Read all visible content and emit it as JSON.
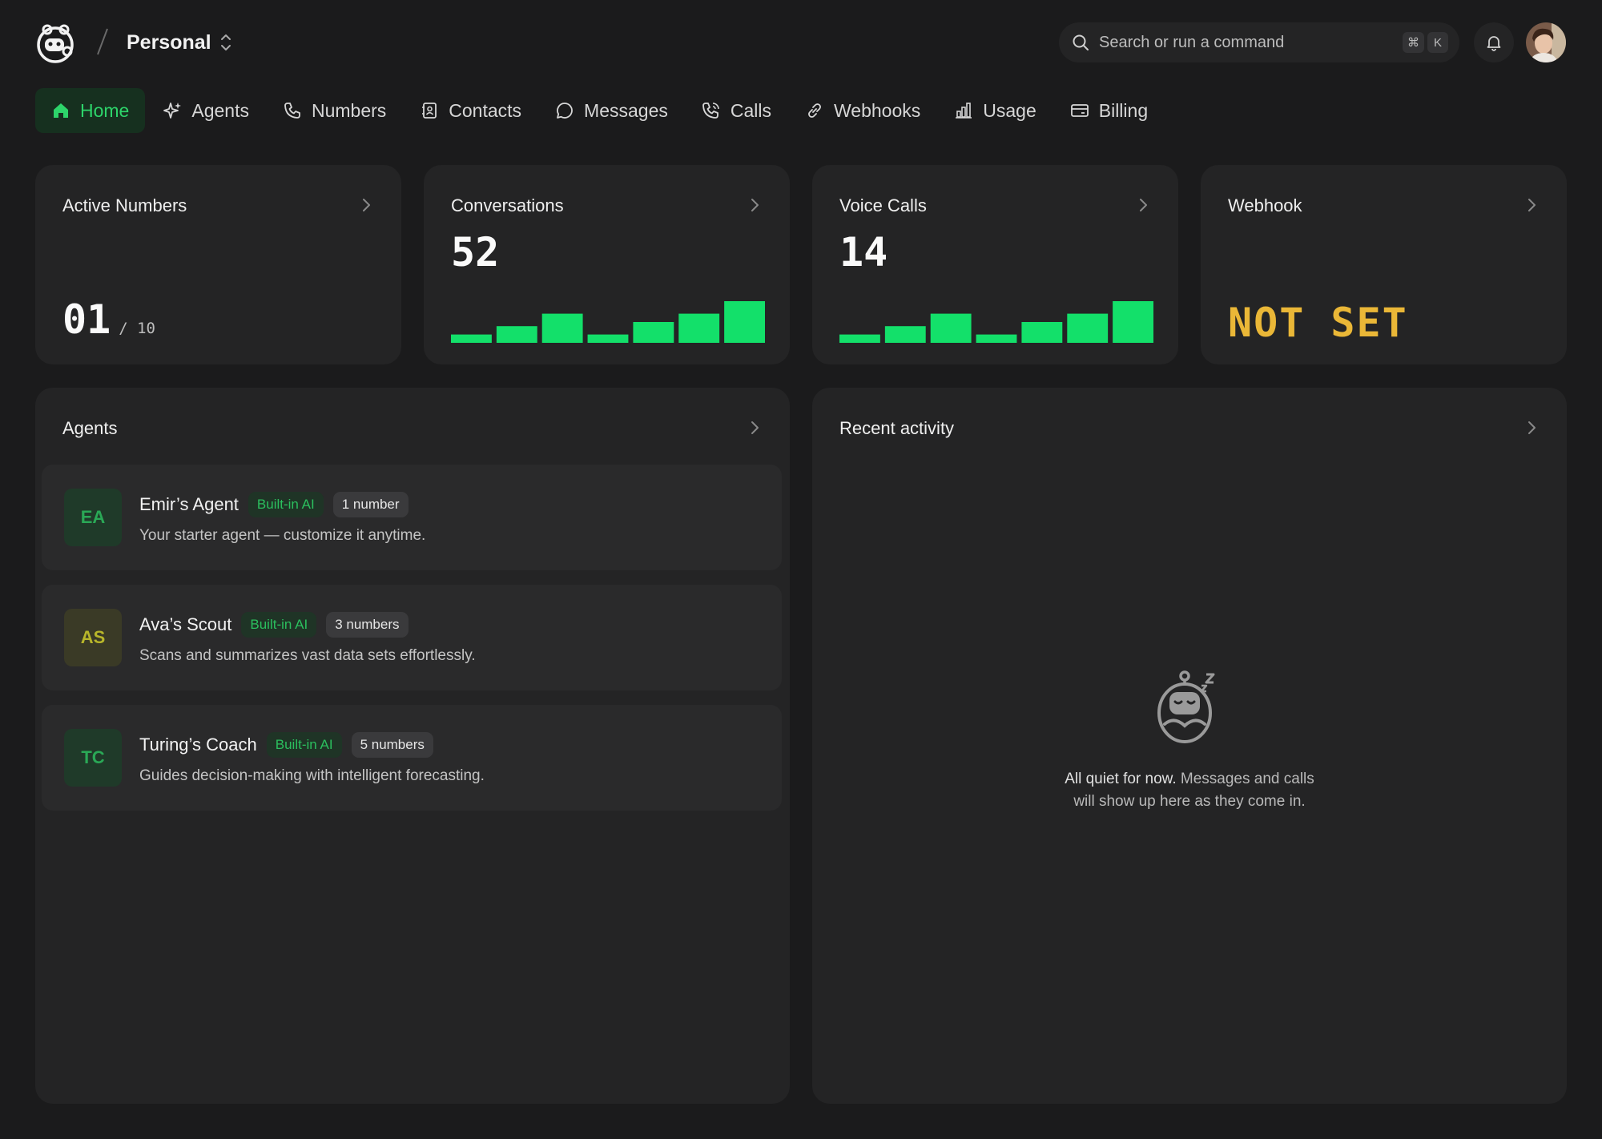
{
  "header": {
    "workspace": "Personal",
    "search_placeholder": "Search or run a command",
    "shortcut_mod": "⌘",
    "shortcut_key": "K"
  },
  "nav": {
    "tabs": [
      {
        "label": "Home",
        "icon": "home-icon",
        "active": true
      },
      {
        "label": "Agents",
        "icon": "sparkle-icon"
      },
      {
        "label": "Numbers",
        "icon": "phone-icon"
      },
      {
        "label": "Contacts",
        "icon": "contact-book-icon"
      },
      {
        "label": "Messages",
        "icon": "chat-bubble-icon"
      },
      {
        "label": "Calls",
        "icon": "phone-call-icon"
      },
      {
        "label": "Webhooks",
        "icon": "link-icon"
      },
      {
        "label": "Usage",
        "icon": "bar-chart-icon"
      },
      {
        "label": "Billing",
        "icon": "credit-card-icon"
      }
    ]
  },
  "stats": {
    "active_numbers": {
      "title": "Active Numbers",
      "value": "01",
      "total": "/ 10"
    },
    "conversations": {
      "title": "Conversations",
      "value": "52",
      "spark": [
        2,
        4,
        7,
        2,
        5,
        7,
        10
      ]
    },
    "voice_calls": {
      "title": "Voice Calls",
      "value": "14",
      "spark": [
        2,
        4,
        7,
        2,
        5,
        7,
        10
      ]
    },
    "webhook": {
      "title": "Webhook",
      "status": "NOT SET",
      "status_color": "#eab737"
    }
  },
  "agents": {
    "title": "Agents",
    "items": [
      {
        "initials": "EA",
        "name": "Emir’s Agent",
        "badge": "Built-in AI",
        "numbers": "1 number",
        "desc": "Your starter agent — customize it anytime.",
        "color": "#2aa856",
        "bg": "#1f3a29"
      },
      {
        "initials": "AS",
        "name": "Ava’s Scout",
        "badge": "Built-in AI",
        "numbers": "3 numbers",
        "desc": "Scans and summarizes vast data sets effortlessly.",
        "color": "#b8b62a",
        "bg": "#3a3a26"
      },
      {
        "initials": "TC",
        "name": "Turing’s Coach",
        "badge": "Built-in AI",
        "numbers": "5 numbers",
        "desc": "Guides decision-making with intelligent forecasting.",
        "color": "#2aa856",
        "bg": "#1f3a29"
      }
    ]
  },
  "activity": {
    "title": "Recent activity",
    "empty_strong": "All quiet for now.",
    "empty_rest_1": " Messages and calls",
    "empty_rest_2": "will show up here as they come in."
  },
  "colors": {
    "accent": "#2dd46a",
    "spark": "#13e06a",
    "card": "#242425",
    "bg": "#1b1b1c"
  }
}
